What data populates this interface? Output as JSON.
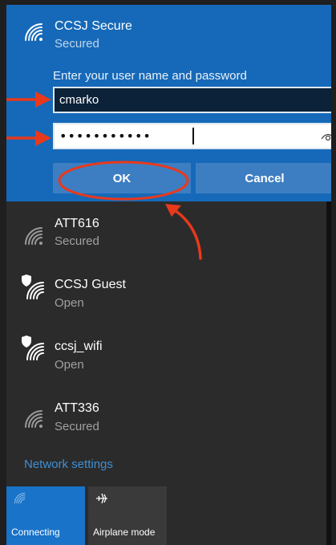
{
  "active_network": {
    "name": "CCSJ Secure",
    "status": "Secured",
    "prompt": "Enter your user name and password",
    "username_value": "cmarko",
    "password_value": "•••••••••••",
    "ok_label": "OK",
    "cancel_label": "Cancel",
    "icon": "wifi-icon"
  },
  "networks": [
    {
      "name": "ATT616",
      "status": "Secured",
      "icon": "wifi-icon"
    },
    {
      "name": "CCSJ Guest",
      "status": "Open",
      "icon": "wifi-shield-icon"
    },
    {
      "name": "ccsj_wifi",
      "status": "Open",
      "icon": "wifi-shield-icon"
    },
    {
      "name": "ATT336",
      "status": "Secured",
      "icon": "wifi-icon"
    }
  ],
  "settings_link": "Network settings",
  "tiles": [
    {
      "label": "Connecting",
      "icon": "wifi-icon",
      "active": true
    },
    {
      "label": "Airplane mode",
      "icon": "airplane-icon",
      "active": false
    }
  ],
  "colors": {
    "accent": "#1669b8",
    "button": "#3d7ec2",
    "link": "#3f8fd6",
    "annotation": "#e8391c"
  }
}
